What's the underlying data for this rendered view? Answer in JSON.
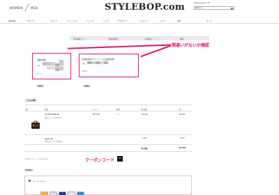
{
  "header": {
    "gender_women": "WOMEN",
    "gender_men": "MEN",
    "logo": "STYLEBOP.com",
    "top_links": "Ship to Japan  ¥ JPY",
    "search_placeholder": "検索する"
  },
  "nav": {
    "items": [
      "新着商品",
      "デザイナー",
      "ブランド",
      "ファッション",
      "シューズ",
      "バッグ",
      "アクセサリー",
      "ジュエリー",
      "ギフト",
      "特集"
    ],
    "sale": "セール"
  },
  "steps": [
    "買い物カゴ",
    "配送先住所",
    "お支払い",
    "確認"
  ],
  "billing": {
    "title": "請求先住所",
    "label_name": "氏名",
    "label_email": "Eメール",
    "change": "変更"
  },
  "shipping": {
    "title": "配送先住所(ギフトカードのみ使用可能)",
    "label_name": "氏名",
    "label_other": "JAPAN",
    "change": "変更"
  },
  "annotation_top": "間違いがないか確認",
  "annotation_coupon": "クーポンコード",
  "order": {
    "title": "ご注文内容",
    "headers": [
      "商品",
      "詳細",
      "サイズ",
      "数量",
      "商品価格",
      "合計"
    ],
    "row": {
      "brand": "DOLCE&GABBANA",
      "desc": "商品コード 12345678",
      "size": "ONE SIZE",
      "qty": "1",
      "price": "320,000",
      "total": "320,000"
    },
    "shipping_label": "配送料 日本",
    "shipping_desc": "(お届けまで3〜5営業日)",
    "shipping_price": "4,000",
    "shipping_total": "4,000",
    "sum_label": "合計金額",
    "sum_value": "324,000"
  },
  "coupon": {
    "label": "プロモーション・ギフトコード",
    "button": "OK"
  },
  "payment": {
    "title": "お支払い",
    "option": "クレジットカード"
  },
  "colors": {
    "accent": "#e5175f",
    "sale": "#d0002a"
  }
}
